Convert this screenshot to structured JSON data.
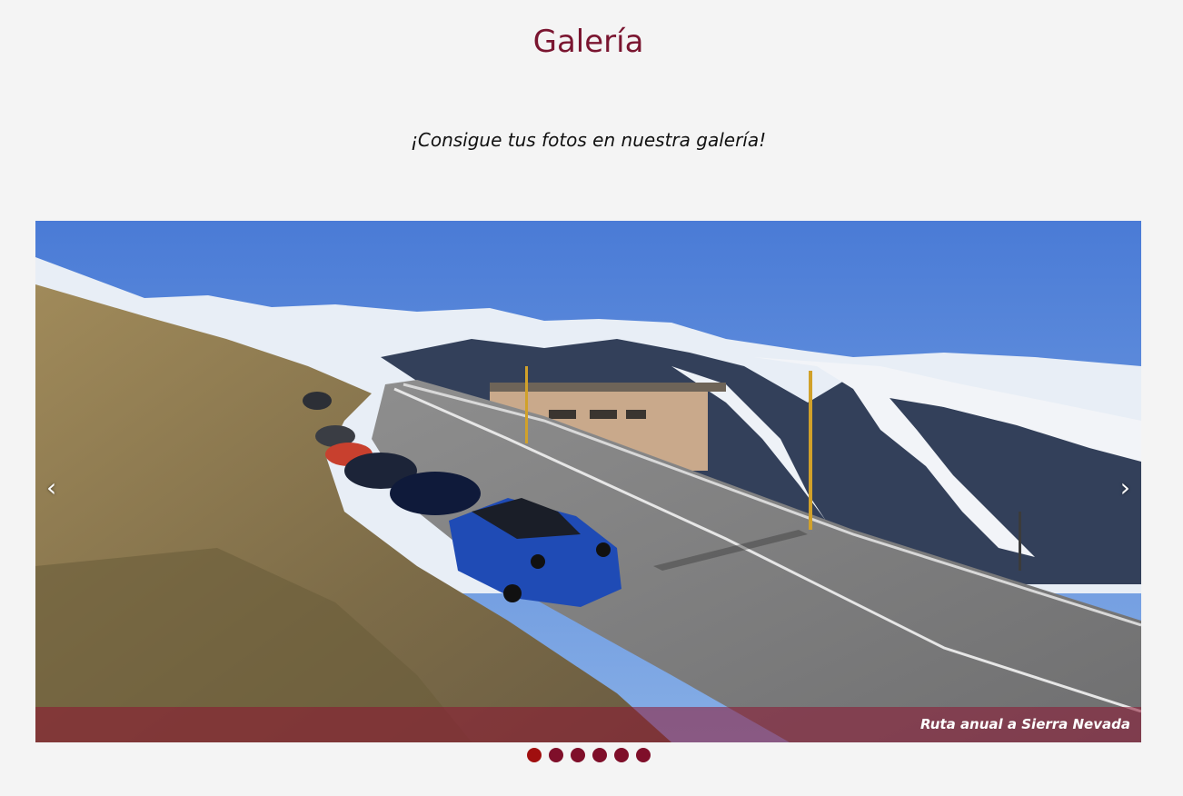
{
  "page": {
    "title": "Galería",
    "subtitle": "¡Consigue tus fotos en nuestra galería!"
  },
  "carousel": {
    "image_icon": "mountain-road-photo",
    "prev_label": "‹",
    "next_label": "›",
    "caption": "Ruta anual a Sierra Nevada",
    "slide_count": 6,
    "active_slide": 1
  },
  "colors": {
    "accent": "#7a1530",
    "dot": "#7f0f2a",
    "dot_active": "#a00f0f",
    "caption_bar": "rgba(140,20,50,0.55)"
  }
}
